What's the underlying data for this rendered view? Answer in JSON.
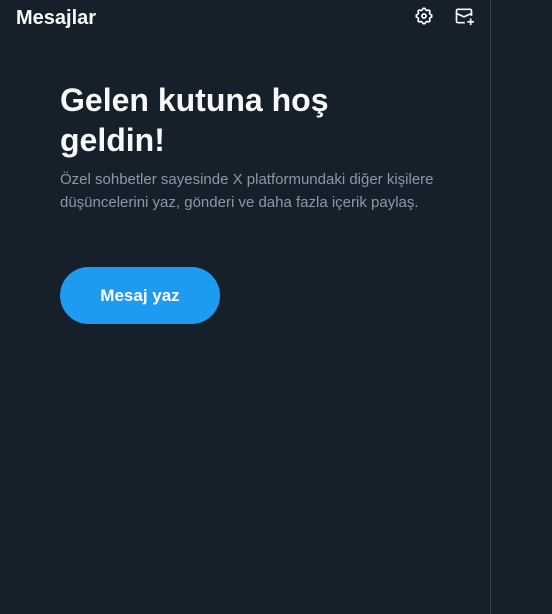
{
  "header": {
    "title": "Mesajlar",
    "settings_icon": "gear-icon",
    "new_message_icon": "envelope-plus-icon"
  },
  "welcome": {
    "heading": "Gelen kutuna hoş geldin!",
    "description": "Özel sohbetler sayesinde X platformundaki diğer kişilere düşüncelerini yaz, gönderi ve daha fazla içerik paylaş.",
    "button_label": "Mesaj yaz"
  },
  "colors": {
    "background": "#15202b",
    "accent": "#1d9bf0",
    "text_primary": "#f7f9f9",
    "text_secondary": "#8b98a5",
    "divider": "#38444d"
  }
}
